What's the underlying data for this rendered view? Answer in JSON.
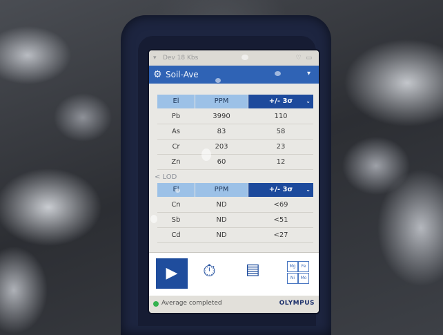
{
  "status_bar": {
    "signal": "▾",
    "network": "Dev 18 Kbs",
    "icons": "♡ ▭"
  },
  "title_bar": {
    "title": "Soil-Ave",
    "gear_icon": "gear-icon",
    "caret": "▾"
  },
  "results_table": {
    "headers": [
      "El",
      "PPM",
      "+/- 3σ"
    ],
    "rows": [
      [
        "Pb",
        "3990",
        "110"
      ],
      [
        "As",
        "83",
        "58"
      ],
      [
        "Cr",
        "203",
        "23"
      ],
      [
        "Zn",
        "60",
        "12"
      ]
    ]
  },
  "lod_section": {
    "label": "< LOD"
  },
  "lod_table": {
    "headers": [
      "El",
      "PPM",
      "+/- 3σ"
    ],
    "rows": [
      [
        "Cn",
        "ND",
        "<69"
      ],
      [
        "Sb",
        "ND",
        "<51"
      ],
      [
        "Cd",
        "ND",
        "<27"
      ]
    ]
  },
  "tab_bar": {
    "play_icon": "▶",
    "timer_icon": "⏱",
    "chat_icon": "▤",
    "periodic_icon": [
      "Mg",
      "Fe",
      "Ni",
      "Mo"
    ]
  },
  "footer": {
    "status": "Average completed",
    "brand": "OLYMPUS"
  },
  "colors": {
    "accent": "#2f63b5",
    "header_dark": "#1d4a9c",
    "header_light": "#9cc1e7",
    "status_ok": "#34b24f"
  }
}
